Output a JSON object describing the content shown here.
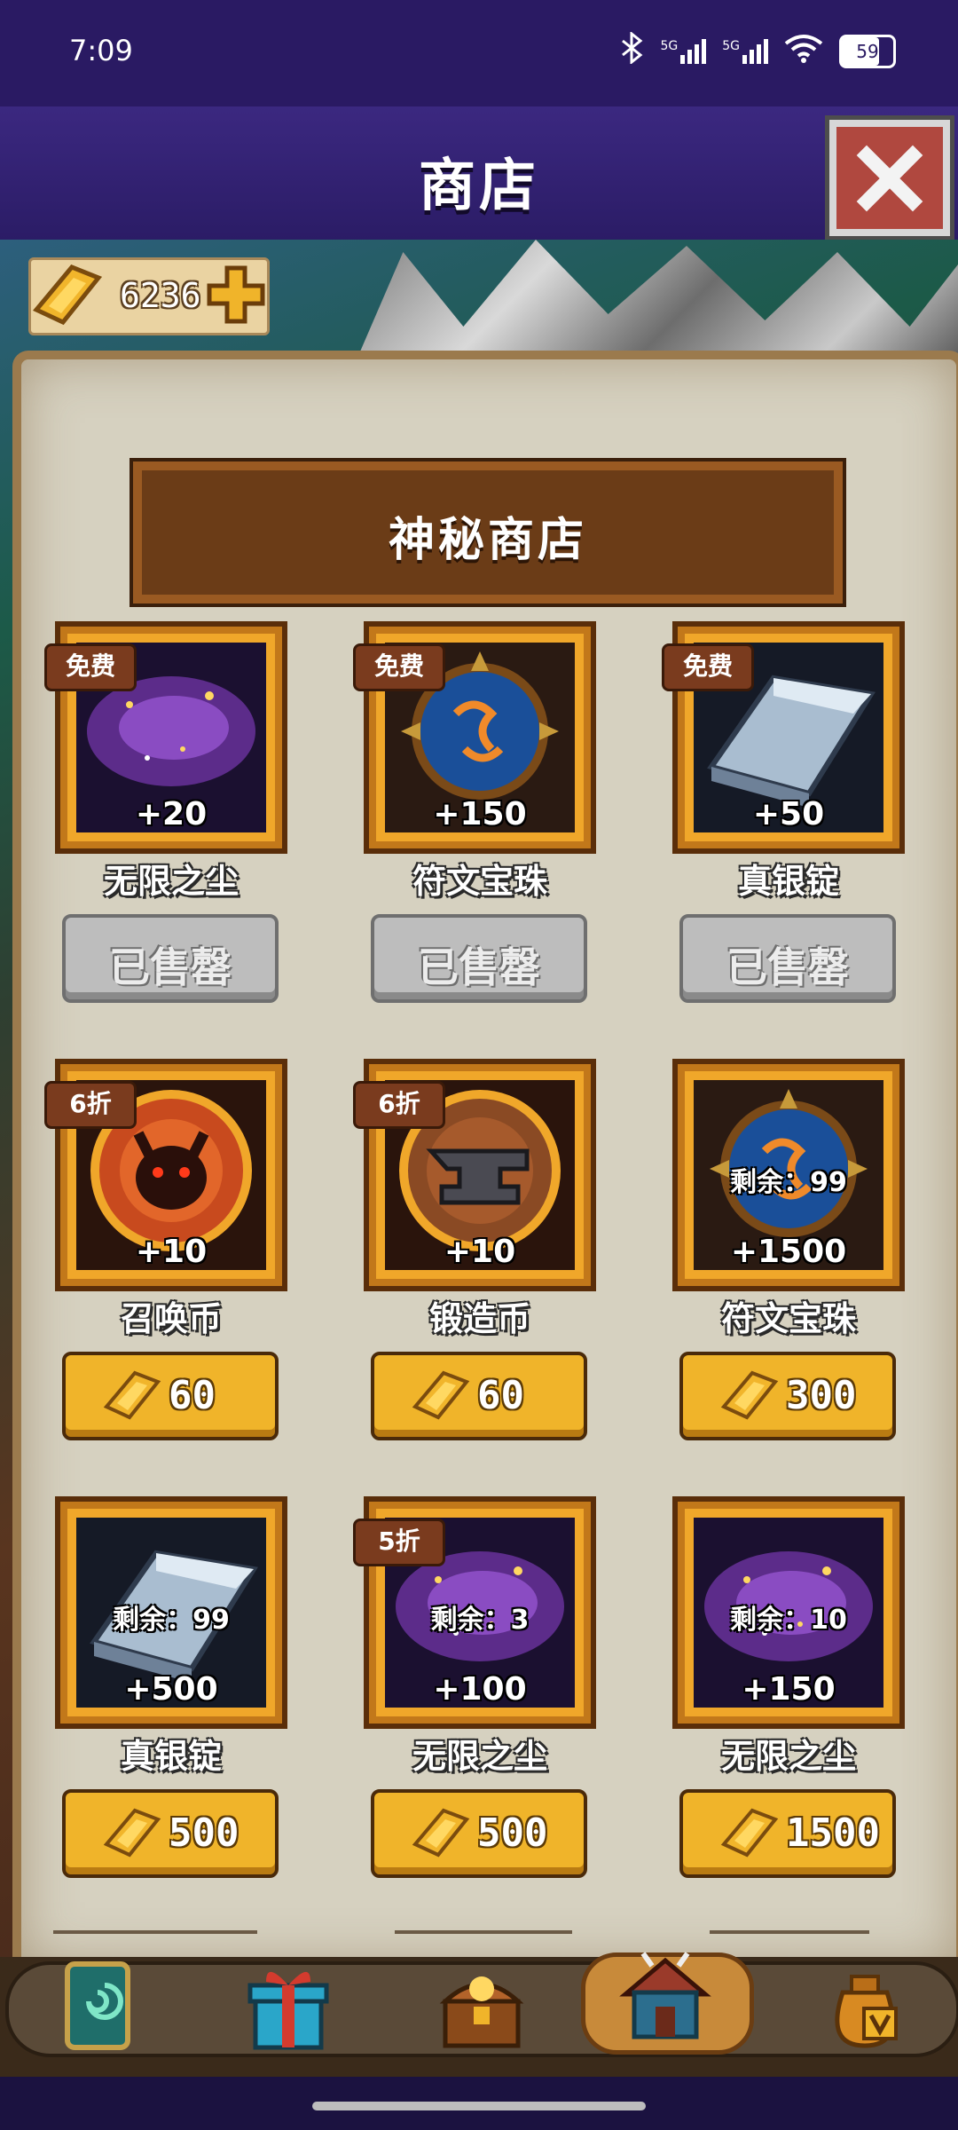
{
  "status": {
    "time": "7:09",
    "net1": "5G",
    "net2": "5G",
    "battery": "59"
  },
  "header": {
    "title": "商店"
  },
  "currency": {
    "amount": "6236"
  },
  "shop": {
    "banner": "神秘商店",
    "sold_label": "已售罄",
    "items": [
      {
        "badge": "免费",
        "art": "dust",
        "qty": "+20",
        "remaining": "",
        "name": "无限之尘",
        "price": "",
        "sold": true
      },
      {
        "badge": "免费",
        "art": "orb",
        "qty": "+150",
        "remaining": "",
        "name": "符文宝珠",
        "price": "",
        "sold": true
      },
      {
        "badge": "免费",
        "art": "silver",
        "qty": "+50",
        "remaining": "",
        "name": "真银锭",
        "price": "",
        "sold": true
      },
      {
        "badge": "6折",
        "art": "summon",
        "qty": "+10",
        "remaining": "",
        "name": "召唤币",
        "price": "60",
        "sold": false
      },
      {
        "badge": "6折",
        "art": "forge",
        "qty": "+10",
        "remaining": "",
        "name": "锻造币",
        "price": "60",
        "sold": false
      },
      {
        "badge": "",
        "art": "orb",
        "qty": "+1500",
        "remaining": "剩余：99",
        "name": "符文宝珠",
        "price": "300",
        "sold": false
      },
      {
        "badge": "",
        "art": "silver",
        "qty": "+500",
        "remaining": "剩余：99",
        "name": "真银锭",
        "price": "500",
        "sold": false
      },
      {
        "badge": "5折",
        "art": "dust",
        "qty": "+100",
        "remaining": "剩余：3",
        "name": "无限之尘",
        "price": "500",
        "sold": false
      },
      {
        "badge": "",
        "art": "dust",
        "qty": "+150",
        "remaining": "剩余：10",
        "name": "无限之尘",
        "price": "1500",
        "sold": false
      }
    ]
  },
  "nav": {
    "items": [
      {
        "icon": "card-icon"
      },
      {
        "icon": "gift-icon"
      },
      {
        "icon": "treasure-chest-icon"
      },
      {
        "icon": "shop-hut-icon",
        "active": true
      },
      {
        "icon": "vip-bag-icon"
      }
    ]
  }
}
